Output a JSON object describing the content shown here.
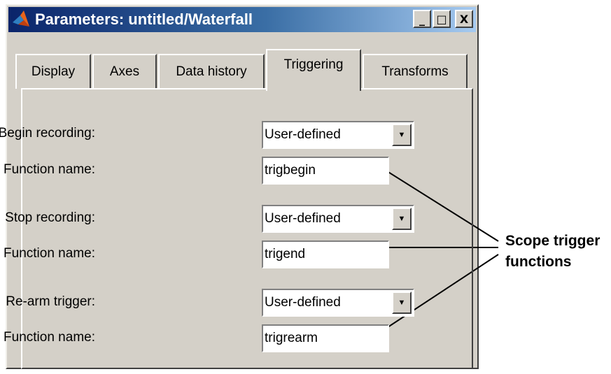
{
  "window": {
    "title": "Parameters: untitled/Waterfall",
    "icon": "matlab-logo-icon",
    "caption_buttons": [
      "_",
      "□",
      "X"
    ]
  },
  "tabs": [
    {
      "label": "Display",
      "active": false
    },
    {
      "label": "Axes",
      "active": false
    },
    {
      "label": "Data history",
      "active": false
    },
    {
      "label": "Triggering",
      "active": true
    },
    {
      "label": "Transforms",
      "active": false
    }
  ],
  "fields": {
    "begin_recording": {
      "label": "Begin recording:",
      "value": "User-defined"
    },
    "begin_function": {
      "label": "Function name:",
      "value": "trigbegin"
    },
    "stop_recording": {
      "label": "Stop recording:",
      "value": "User-defined"
    },
    "stop_function": {
      "label": "Function name:",
      "value": "trigend"
    },
    "rearm_trigger": {
      "label": "Re-arm trigger:",
      "value": "User-defined"
    },
    "rearm_function": {
      "label": "Function name:",
      "value": "trigrearm"
    }
  },
  "annotation": {
    "line1": "Scope trigger",
    "line2": "functions"
  }
}
